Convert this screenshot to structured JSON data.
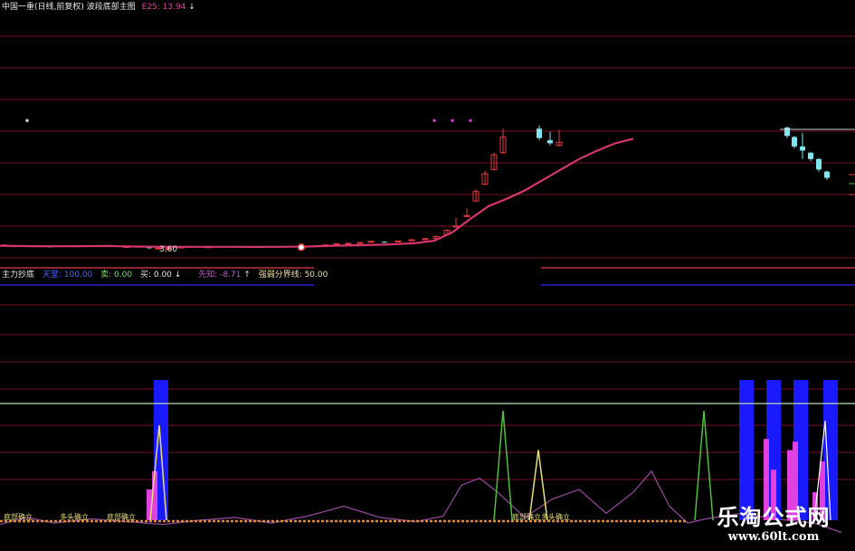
{
  "colors": {
    "background": "#000000",
    "grid": "#7a1020",
    "up_candle": "#e83a3a",
    "down_candle": "#7fe6ee",
    "ema_line": "#d6356f",
    "threshold_line": "#b6e0b6",
    "blue_bar": "#1a1aff",
    "magenta_bar": "#e040e0",
    "green_spike": "#4fbf3f",
    "yellow_spike": "#e8e07a",
    "purple_line": "#9a4aa0",
    "baseline": "#e08a3a",
    "header_text": "#e8e8e8",
    "indicator_red": "#e83a3a"
  },
  "upper_header": {
    "title": "中国一重(日线,前复权) 波段底部主图",
    "ema_label": "E25: 13.94",
    "arrow": "↓"
  },
  "lower_header": {
    "name": "主力抄底",
    "item1": "天堂: 100.00",
    "item2": "卖: 0.00",
    "item3": "买: 0.00",
    "arrow": "↓",
    "item4": "先知: -8.71",
    "arrow2": "↑",
    "item5": "强弱分界线: 50.00"
  },
  "price_label": "3.60",
  "bottom_labels": [
    "底部确立",
    "多头确立",
    "底部确立",
    "底部确立",
    "多头确立"
  ],
  "watermark": {
    "title": "乐淘公式网",
    "url": "www.60lt.com"
  },
  "chart_data": [
    {
      "type": "candlestick",
      "title": "中国一重(日线,前复权) 波段底部主图",
      "series": [
        {
          "name": "E25",
          "kind": "line",
          "x": [
            0,
            20,
            40,
            60,
            80,
            100,
            120,
            140,
            160,
            180,
            200,
            220,
            240,
            260,
            280,
            300,
            320,
            340,
            360,
            380,
            400,
            420,
            440,
            460,
            480,
            500,
            520,
            540,
            560,
            580,
            600,
            620,
            640,
            660,
            680,
            700
          ],
          "values": [
            3.72,
            3.7,
            3.68,
            3.67,
            3.68,
            3.69,
            3.7,
            3.66,
            3.64,
            3.63,
            3.62,
            3.62,
            3.62,
            3.62,
            3.61,
            3.62,
            3.63,
            3.65,
            3.7,
            3.74,
            3.78,
            3.82,
            3.88,
            3.98,
            4.2,
            5.0,
            6.3,
            7.5,
            8.2,
            9.0,
            10.0,
            11.0,
            12.0,
            12.8,
            13.5,
            13.94
          ]
        }
      ],
      "candles": [
        {
          "x": 5,
          "open": 3.75,
          "close": 3.8,
          "high": 3.85,
          "low": 3.7
        },
        {
          "x": 15,
          "open": 3.7,
          "close": 3.72,
          "high": 3.76,
          "low": 3.66
        },
        {
          "x": 25,
          "open": 3.72,
          "close": 3.68,
          "high": 3.75,
          "low": 3.64
        },
        {
          "x": 55,
          "open": 3.66,
          "close": 3.62,
          "high": 3.68,
          "low": 3.6
        },
        {
          "x": 90,
          "open": 3.72,
          "close": 3.74,
          "high": 3.78,
          "low": 3.7
        },
        {
          "x": 120,
          "open": 3.75,
          "close": 3.72,
          "high": 3.78,
          "low": 3.68
        },
        {
          "x": 140,
          "open": 3.62,
          "close": 3.64,
          "high": 3.7,
          "low": 3.58
        },
        {
          "x": 165,
          "open": 3.58,
          "close": 3.55,
          "high": 3.6,
          "low": 3.4
        },
        {
          "x": 175,
          "open": 3.5,
          "close": 3.5,
          "high": 3.55,
          "low": 3.4
        },
        {
          "x": 186,
          "open": 3.45,
          "close": 3.45,
          "high": 3.5,
          "low": 3.35
        },
        {
          "x": 200,
          "open": 3.55,
          "close": 3.6,
          "high": 3.62,
          "low": 3.52
        },
        {
          "x": 230,
          "open": 3.6,
          "close": 3.62,
          "high": 3.65,
          "low": 3.58
        },
        {
          "x": 290,
          "open": 3.6,
          "close": 3.58,
          "high": 3.62,
          "low": 3.56
        },
        {
          "x": 333,
          "open": 3.5,
          "close": 3.6,
          "high": 3.7,
          "low": 3.45
        },
        {
          "x": 360,
          "open": 3.72,
          "close": 3.8,
          "high": 3.84,
          "low": 3.7
        },
        {
          "x": 372,
          "open": 3.82,
          "close": 3.92,
          "high": 3.96,
          "low": 3.8
        },
        {
          "x": 385,
          "open": 3.92,
          "close": 3.95,
          "high": 4.0,
          "low": 3.88
        },
        {
          "x": 398,
          "open": 3.98,
          "close": 4.02,
          "high": 4.06,
          "low": 3.94
        },
        {
          "x": 410,
          "open": 4.05,
          "close": 4.15,
          "high": 4.2,
          "low": 4.02
        },
        {
          "x": 425,
          "open": 4.1,
          "close": 4.05,
          "high": 4.15,
          "low": 4.0
        },
        {
          "x": 440,
          "open": 4.08,
          "close": 4.18,
          "high": 4.22,
          "low": 4.05
        },
        {
          "x": 455,
          "open": 4.2,
          "close": 4.3,
          "high": 4.35,
          "low": 4.15
        },
        {
          "x": 470,
          "open": 4.3,
          "close": 4.4,
          "high": 4.45,
          "low": 4.25
        },
        {
          "x": 482,
          "open": 4.4,
          "close": 4.6,
          "high": 4.7,
          "low": 4.35
        },
        {
          "x": 494,
          "open": 4.8,
          "close": 5.2,
          "high": 5.3,
          "low": 4.7
        },
        {
          "x": 504,
          "open": 5.6,
          "close": 5.6,
          "high": 6.4,
          "low": 5.6
        },
        {
          "x": 516,
          "open": 6.6,
          "close": 6.6,
          "high": 7.3,
          "low": 6.6
        },
        {
          "x": 526,
          "open": 8.0,
          "close": 8.9,
          "high": 9.1,
          "low": 7.9
        },
        {
          "x": 536,
          "open": 9.6,
          "close": 10.6,
          "high": 10.9,
          "low": 9.5
        },
        {
          "x": 546,
          "open": 11.0,
          "close": 12.4,
          "high": 12.6,
          "low": 10.9
        },
        {
          "x": 556,
          "open": 12.6,
          "close": 14.1,
          "high": 14.9,
          "low": 12.5
        },
        {
          "x": 596,
          "open": 14.9,
          "close": 14.0,
          "high": 15.2,
          "low": 13.8
        },
        {
          "x": 608,
          "open": 13.8,
          "close": 13.5,
          "high": 14.6,
          "low": 13.3
        },
        {
          "x": 618,
          "open": 13.3,
          "close": 13.6,
          "high": 14.8,
          "low": 13.2
        },
        {
          "x": 870,
          "open": 15.0,
          "close": 14.2,
          "high": 15.1,
          "low": 14.0
        },
        {
          "x": 878,
          "open": 14.1,
          "close": 13.2,
          "high": 14.2,
          "low": 13.0
        },
        {
          "x": 887,
          "open": 13.2,
          "close": 12.8,
          "high": 14.5,
          "low": 12.0
        },
        {
          "x": 896,
          "open": 12.6,
          "close": 12.0,
          "high": 12.7,
          "low": 11.8
        },
        {
          "x": 905,
          "open": 12.0,
          "close": 11.0,
          "high": 12.1,
          "low": 10.8
        },
        {
          "x": 914,
          "open": 10.8,
          "close": 10.2,
          "high": 10.9,
          "low": 10.0
        }
      ],
      "markers": [
        {
          "x": 30,
          "y": 15.8,
          "color": "#e8e8e8"
        },
        {
          "x": 480,
          "y": 15.8,
          "color": "#e040e0"
        },
        {
          "x": 500,
          "y": 15.8,
          "color": "#e040e0"
        },
        {
          "x": 520,
          "y": 15.8,
          "color": "#e040e0"
        }
      ]
    },
    {
      "type": "bar",
      "title": "主力抄底",
      "series": [
        {
          "name": "天堂",
          "kind": "bar",
          "color": "blue",
          "x": [
            178,
            825,
            855,
            885,
            918
          ],
          "values": [
            100,
            100,
            100,
            100,
            100
          ]
        },
        {
          "name": "卖",
          "kind": "spike",
          "color": "green",
          "x": [
            556,
            778
          ],
          "values": [
            78,
            78
          ]
        },
        {
          "name": "买",
          "kind": "spike",
          "color": "yellow",
          "x": [
            595
          ],
          "values": [
            50
          ]
        },
        {
          "name": "先知",
          "kind": "line",
          "color": "purple",
          "x": [
            0,
            30,
            60,
            100,
            140,
            180,
            220,
            260,
            300,
            340,
            380,
            420,
            460,
            490,
            510,
            530,
            550,
            580,
            610,
            640,
            670,
            700,
            720,
            740,
            760,
            780,
            800,
            820,
            845,
            870,
            900,
            930
          ],
          "values": [
            -3,
            2,
            -2,
            1,
            -1,
            -3,
            0,
            2,
            -2,
            3,
            10,
            2,
            -1,
            3,
            25,
            30,
            20,
            2,
            15,
            22,
            5,
            20,
            35,
            10,
            -2,
            1,
            3,
            5,
            2,
            0,
            -2,
            -8.71
          ]
        },
        {
          "name": "强弱分界线",
          "kind": "line",
          "color": "white",
          "x": [
            0,
            945
          ],
          "values": [
            50,
            50
          ]
        }
      ]
    }
  ]
}
